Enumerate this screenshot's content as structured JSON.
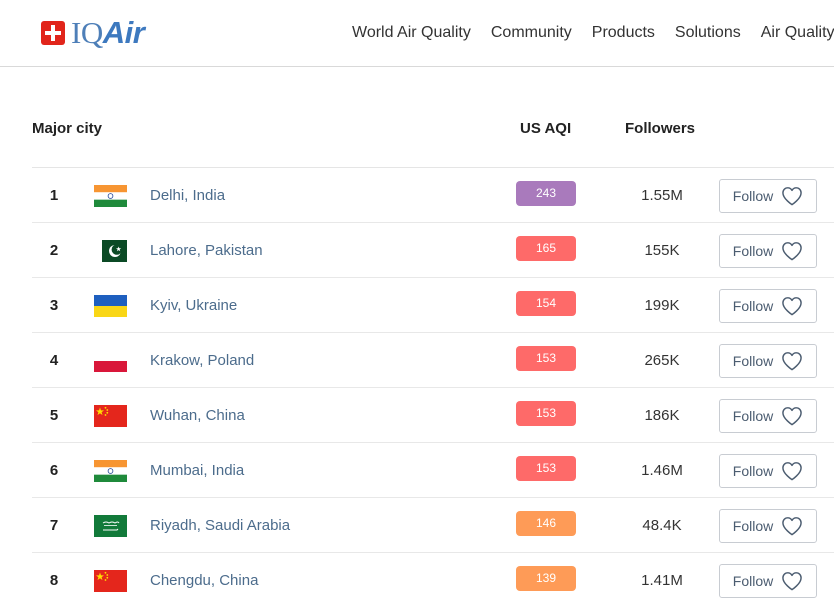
{
  "brand": {
    "iq": "IQ",
    "air": "Air"
  },
  "nav": [
    "World Air Quality",
    "Community",
    "Products",
    "Solutions",
    "Air Quality"
  ],
  "table": {
    "headers": {
      "city": "Major city",
      "aqi": "US AQI",
      "followers": "Followers"
    },
    "follow_label": "Follow",
    "rows": [
      {
        "rank": "1",
        "city": "Delhi, India",
        "aqi": "243",
        "aqi_color": "#a97abc",
        "followers": "1.55M",
        "flag": "india"
      },
      {
        "rank": "2",
        "city": "Lahore, Pakistan",
        "aqi": "165",
        "aqi_color": "#fe6a69",
        "followers": "155K",
        "flag": "pakistan"
      },
      {
        "rank": "3",
        "city": "Kyiv, Ukraine",
        "aqi": "154",
        "aqi_color": "#fe6a69",
        "followers": "199K",
        "flag": "ukraine"
      },
      {
        "rank": "4",
        "city": "Krakow, Poland",
        "aqi": "153",
        "aqi_color": "#fe6a69",
        "followers": "265K",
        "flag": "poland"
      },
      {
        "rank": "5",
        "city": "Wuhan, China",
        "aqi": "153",
        "aqi_color": "#fe6a69",
        "followers": "186K",
        "flag": "china"
      },
      {
        "rank": "6",
        "city": "Mumbai, India",
        "aqi": "153",
        "aqi_color": "#fe6a69",
        "followers": "1.46M",
        "flag": "india"
      },
      {
        "rank": "7",
        "city": "Riyadh, Saudi Arabia",
        "aqi": "146",
        "aqi_color": "#fe9b57",
        "followers": "48.4K",
        "flag": "saudi-arabia"
      },
      {
        "rank": "8",
        "city": "Chengdu, China",
        "aqi": "139",
        "aqi_color": "#fe9b57",
        "followers": "1.41M",
        "flag": "china"
      }
    ]
  }
}
